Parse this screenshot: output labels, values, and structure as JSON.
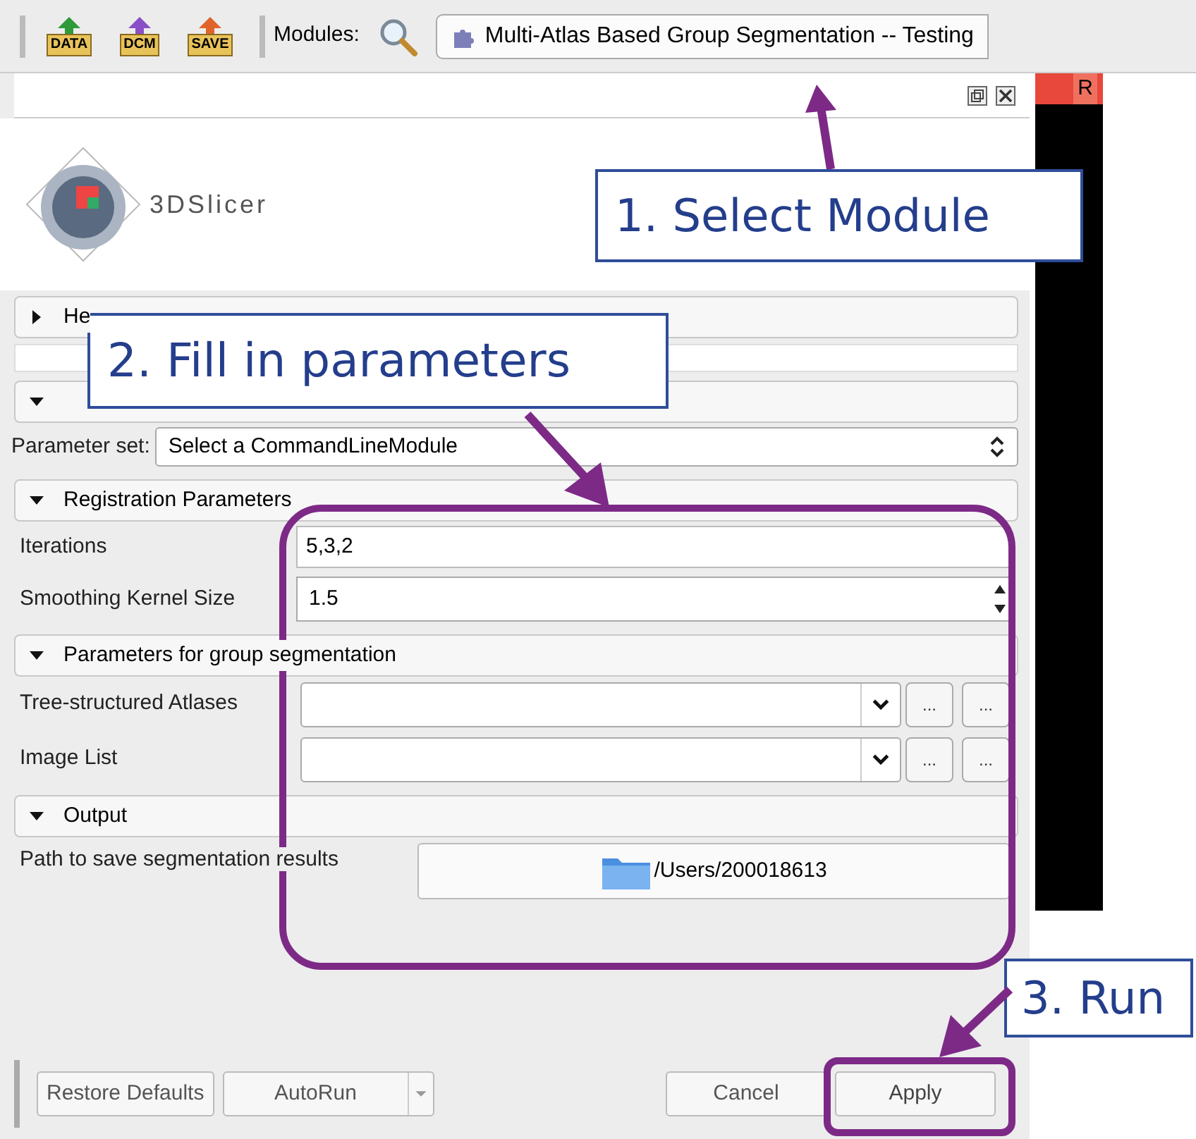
{
  "toolbar": {
    "buttons": [
      {
        "label": "DATA",
        "color": "#2e9a3a"
      },
      {
        "label": "DCM",
        "color": "#8a4fc7"
      },
      {
        "label": "SAVE",
        "color": "#e0642a"
      }
    ],
    "modules_label": "Modules:",
    "module_selector": "Multi-Atlas Based Group Segmentation -- Testing"
  },
  "panel": {
    "logo_text": "3DSlicer"
  },
  "view": {
    "label": "R"
  },
  "sections": [
    {
      "title": "He",
      "expanded": false
    },
    {
      "expanded": true,
      "rows": [
        {
          "kind": "combo",
          "label": "Parameter set:",
          "value": "Select a CommandLineModule"
        }
      ]
    },
    {
      "title": "Registration Parameters",
      "expanded": true,
      "rows": [
        {
          "kind": "text",
          "label": "Iterations",
          "value": "5,3,2"
        },
        {
          "kind": "spin",
          "label": "Smoothing Kernel Size",
          "value": "1.5"
        }
      ]
    },
    {
      "title": "Parameters for group segmentation",
      "expanded": true,
      "rows": [
        {
          "kind": "list",
          "label": "Tree-structured Atlases",
          "buttons": [
            "...",
            "..."
          ]
        },
        {
          "kind": "list",
          "label": "Image List",
          "buttons": [
            "...",
            "..."
          ]
        }
      ]
    },
    {
      "title": "Output",
      "expanded": true,
      "rows": [
        {
          "kind": "directory",
          "label": "Path to save segmentation results",
          "value": "/Users/200018613"
        }
      ]
    }
  ],
  "footer": {
    "restore": "Restore Defaults",
    "autorun": "AutoRun",
    "cancel": "Cancel",
    "apply": "Apply"
  },
  "annotations": [
    "1. Select Module",
    "2. Fill in parameters",
    "3. Run"
  ]
}
